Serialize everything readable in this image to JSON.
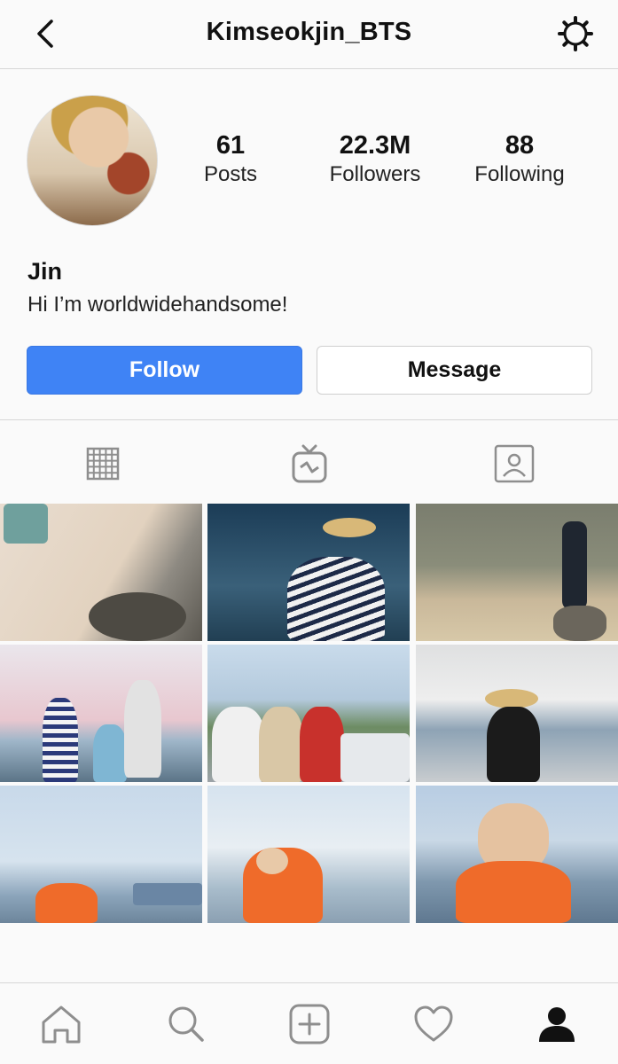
{
  "header": {
    "title": "Kimseokjin_BTS",
    "back_icon": "chevron-left-icon",
    "settings_icon": "gear-icon"
  },
  "profile": {
    "stats": [
      {
        "value": "61",
        "label": "Posts"
      },
      {
        "value": "22.3M",
        "label": "Followers"
      },
      {
        "value": "88",
        "label": "Following"
      }
    ],
    "name": "Jin",
    "bio": "Hi I’m worldwidehandsome!",
    "follow_label": "Follow",
    "message_label": "Message"
  },
  "colors": {
    "accent": "#3f83f5",
    "background": "#fafafa",
    "divider": "#d6d6d6"
  },
  "tabs": [
    {
      "icon": "grid-icon",
      "active": true
    },
    {
      "icon": "igtv-icon",
      "active": false
    },
    {
      "icon": "tagged-icon",
      "active": false
    }
  ],
  "bottom_nav": [
    {
      "icon": "home-icon"
    },
    {
      "icon": "search-icon"
    },
    {
      "icon": "add-post-icon"
    },
    {
      "icon": "heart-icon"
    },
    {
      "icon": "profile-icon",
      "active": true
    }
  ]
}
